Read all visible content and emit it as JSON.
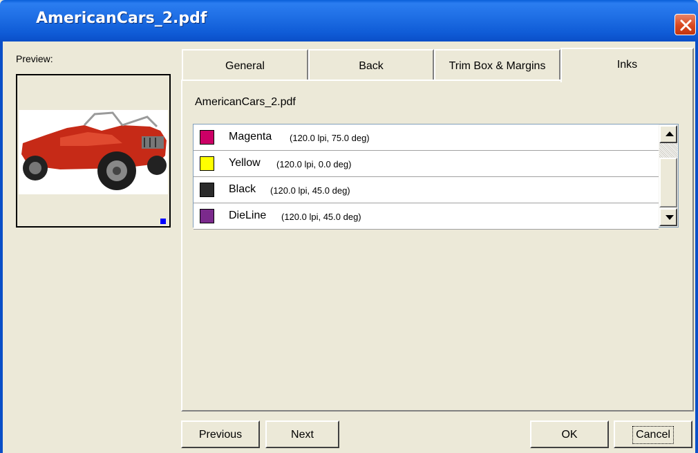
{
  "window": {
    "title": "AmericanCars_2.pdf",
    "close_icon": "close-icon"
  },
  "preview": {
    "label": "Preview:",
    "image": "red jeep thumbnail"
  },
  "tabs": [
    {
      "label": "General",
      "active": false
    },
    {
      "label": "Back",
      "active": false
    },
    {
      "label": "Trim Box & Margins",
      "active": false
    },
    {
      "label": "Inks",
      "active": true
    }
  ],
  "inks_panel": {
    "file_name": "AmericanCars_2.pdf",
    "inks": [
      {
        "name": "Magenta",
        "detail": "(120.0 lpi,  75.0 deg)",
        "color": "#cc0066"
      },
      {
        "name": "Yellow",
        "detail": "(120.0 lpi,  0.0 deg)",
        "color": "#ffff00"
      },
      {
        "name": "Black",
        "detail": "(120.0 lpi,  45.0 deg)",
        "color": "#2b2b2b"
      },
      {
        "name": "DieLine",
        "detail": "(120.0 lpi,  45.0 deg)",
        "color": "#7b2a8c"
      }
    ]
  },
  "buttons": {
    "previous": "Previous",
    "next": "Next",
    "ok": "OK",
    "cancel": "Cancel"
  },
  "colors": {
    "titlebar": "#0f5bd6",
    "dialog_bg": "#ece9d8",
    "close_button": "#d9471e"
  }
}
